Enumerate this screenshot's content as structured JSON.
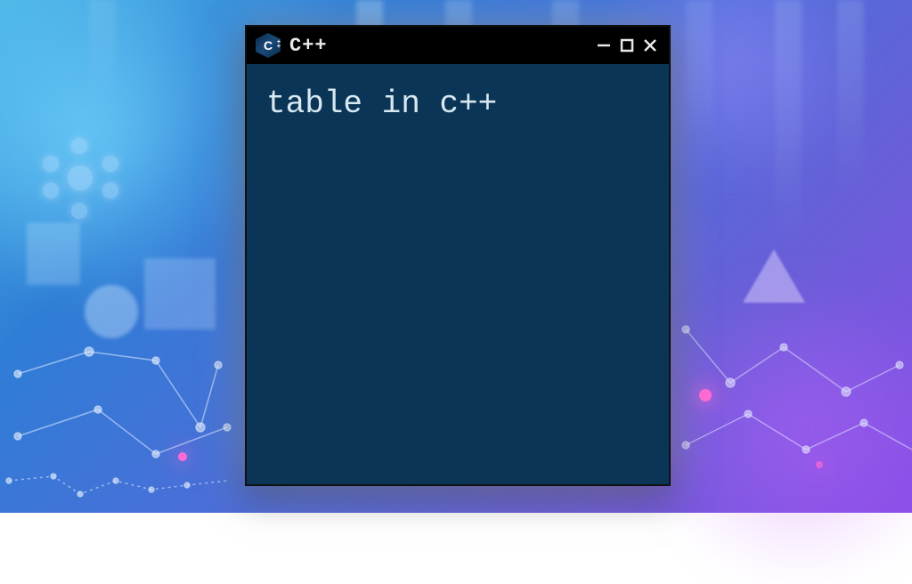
{
  "window": {
    "title": "C++",
    "icon_name": "cpp-hexagon-icon",
    "content_text": "table in c++"
  },
  "colors": {
    "window_bg": "#0a3557",
    "titlebar_bg": "#000000",
    "text_color": "#d8e8f0"
  }
}
